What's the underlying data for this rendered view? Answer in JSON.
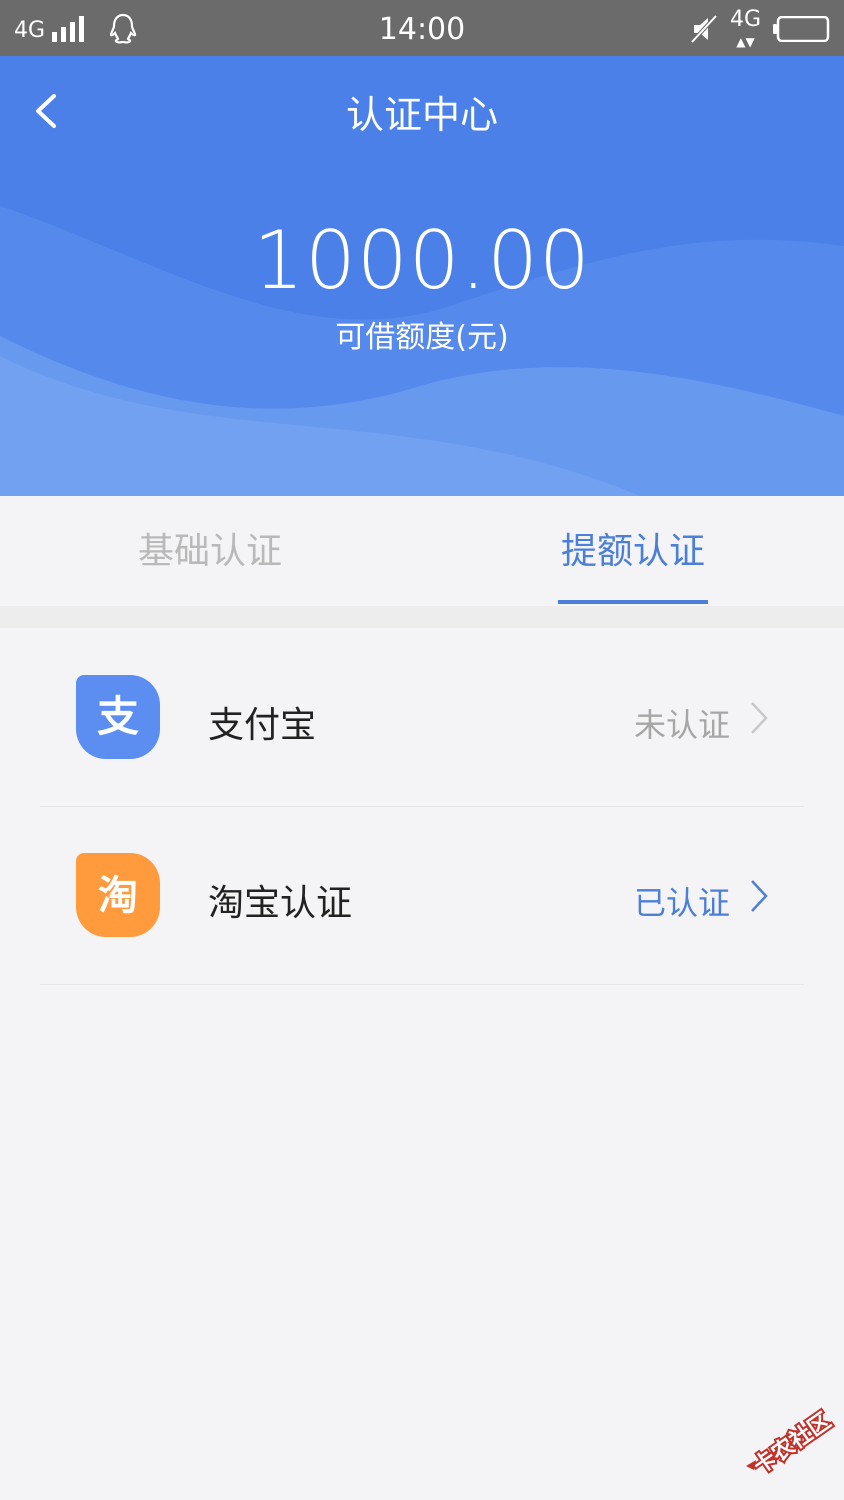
{
  "status_bar": {
    "network": "4G",
    "time": "14:00",
    "network_right": "4G"
  },
  "header": {
    "title": "认证中心",
    "amount": "1000.00",
    "amount_label": "可借额度(元)",
    "accent_color": "#4a80e8"
  },
  "tabs": [
    {
      "label": "基础认证",
      "active": false
    },
    {
      "label": "提额认证",
      "active": true
    }
  ],
  "items": [
    {
      "icon": "alipay-icon",
      "icon_glyph": "支",
      "title": "支付宝",
      "status": "未认证",
      "status_color": "#a6a6a6",
      "icon_color": "#5b8ef0"
    },
    {
      "icon": "taobao-icon",
      "icon_glyph": "淘",
      "title": "淘宝认证",
      "status": "已认证",
      "status_color": "#4b7fd8",
      "icon_color": "#ff9a3d"
    }
  ],
  "watermark": "卡农社区"
}
